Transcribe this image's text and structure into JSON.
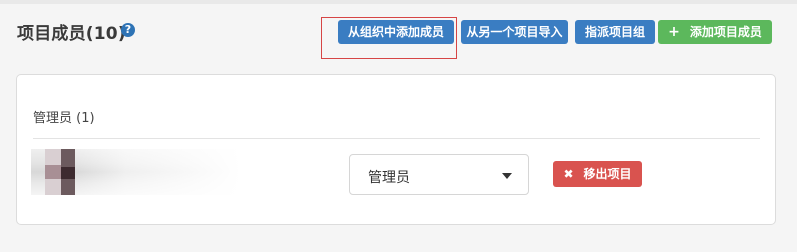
{
  "header": {
    "title": "项目成员(10)",
    "help_icon": "question-circle-icon"
  },
  "actions": {
    "add_from_org": "从组织中添加成员",
    "import_from_other": "从另一个项目导入",
    "assign_group": "指派项目组",
    "add_member": "添加项目成员",
    "add_member_icon": "plus-icon"
  },
  "members": {
    "section_label": "管理员 (1)",
    "rows": [
      {
        "role_value": "管理员",
        "remove_label": "移出项目",
        "remove_icon": "times-icon"
      }
    ]
  },
  "colors": {
    "primary": "#3a7dc2",
    "success": "#5cb85c",
    "danger": "#d9534f",
    "highlight": "#d64545"
  }
}
